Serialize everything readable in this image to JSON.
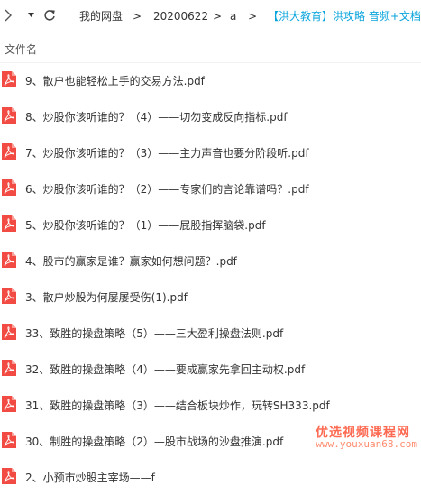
{
  "breadcrumb": {
    "items": [
      "我的网盘",
      "20200622",
      "a"
    ],
    "separator": ">",
    "current": "【洪大教育】洪攻略 音频+文档"
  },
  "header": {
    "column_name": "文件名"
  },
  "files": [
    "9、散户也能轻松上手的交易方法.pdf",
    "8、炒股你该听谁的？（4）——切勿变成反向指标.pdf",
    "7、炒股你该听谁的？（3）——主力声音也要分阶段听.pdf",
    "6、炒股你该听谁的？（2）——专家们的言论靠谱吗？.pdf",
    "5、炒股你该听谁的？（1）——屁股指挥脑袋.pdf",
    "4、股市的赢家是谁？赢家如何想问题？.pdf",
    "3、散户炒股为何屡屡受伤(1).pdf",
    "33、致胜的操盘策略（5）——三大盈利操盘法则.pdf",
    "32、致胜的操盘策略（4）——要成赢家先拿回主动权.pdf",
    "31、致胜的操盘策略（3）——结合板块炒作，玩转SH333.pdf",
    "30、制胜的操盘策略（2）—股市战场的沙盘推演.pdf",
    "2、小预市炒股主宰场——f"
  ],
  "watermark": {
    "line1": "优选视频课程网",
    "line2": "www.youxuan68.com"
  },
  "colors": {
    "pdf_icon": "#f24b43",
    "breadcrumb_current": "#0aa4dc"
  },
  "icons": {
    "back": "chevron-right-icon",
    "dropdown": "caret-down-icon",
    "refresh": "refresh-icon",
    "file": "pdf-file-icon"
  }
}
